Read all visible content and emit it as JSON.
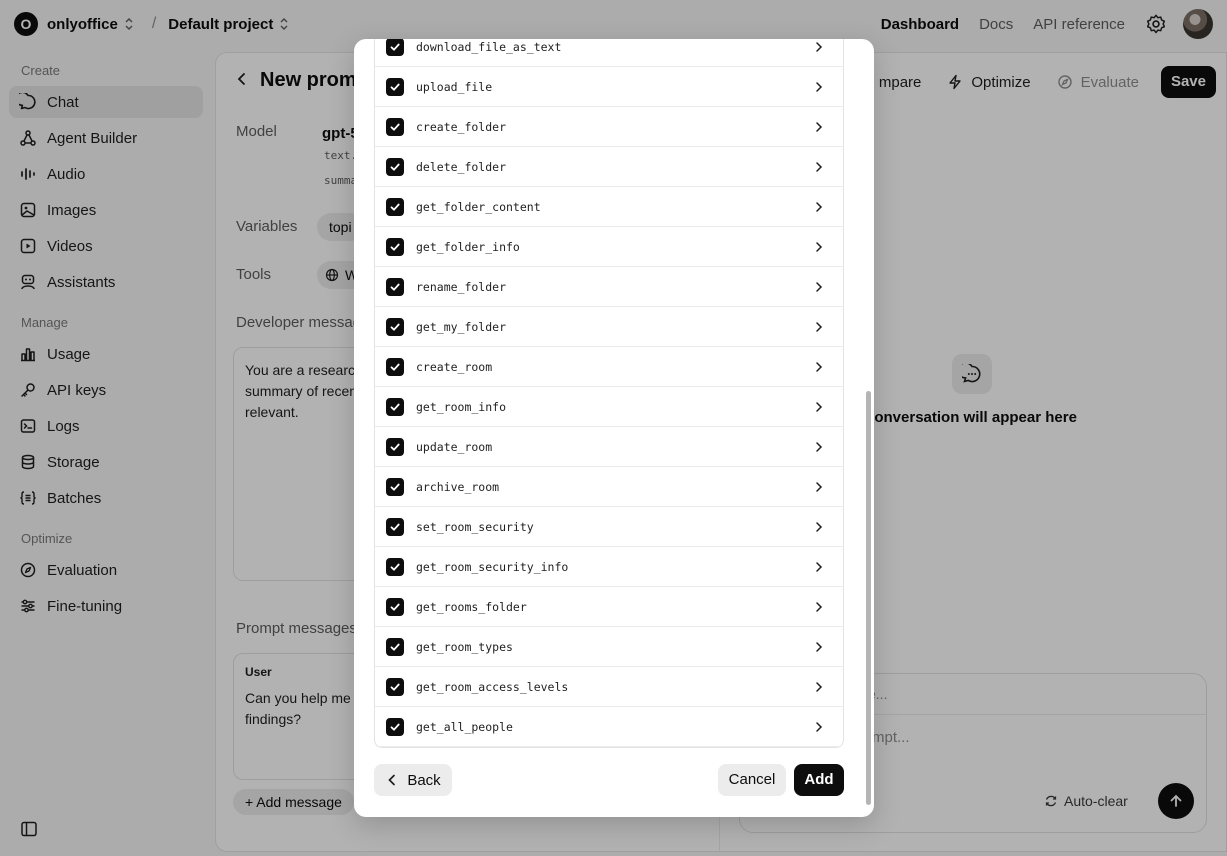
{
  "topbar": {
    "org_initial": "O",
    "org_name": "onlyoffice",
    "separator": "/",
    "project_name": "Default project",
    "links": [
      "Dashboard",
      "Docs",
      "API reference"
    ]
  },
  "sidebar": {
    "sections": [
      {
        "label": "Create",
        "items": [
          {
            "label": "Chat",
            "icon": "chat-icon",
            "active": true
          },
          {
            "label": "Agent Builder",
            "icon": "agent-builder-icon"
          },
          {
            "label": "Audio",
            "icon": "audio-icon"
          },
          {
            "label": "Images",
            "icon": "images-icon"
          },
          {
            "label": "Videos",
            "icon": "videos-icon"
          },
          {
            "label": "Assistants",
            "icon": "assistants-icon"
          }
        ]
      },
      {
        "label": "Manage",
        "items": [
          {
            "label": "Usage",
            "icon": "usage-icon"
          },
          {
            "label": "API keys",
            "icon": "key-icon"
          },
          {
            "label": "Logs",
            "icon": "logs-icon"
          },
          {
            "label": "Storage",
            "icon": "storage-icon"
          },
          {
            "label": "Batches",
            "icon": "batches-icon"
          }
        ]
      },
      {
        "label": "Optimize",
        "items": [
          {
            "label": "Evaluation",
            "icon": "evaluation-icon"
          },
          {
            "label": "Fine-tuning",
            "icon": "fine-tuning-icon"
          }
        ]
      }
    ]
  },
  "main": {
    "title": "New promp",
    "actions": {
      "compare": "mpare",
      "optimize": "Optimize",
      "evaluate": "Evaluate",
      "save": "Save"
    },
    "model_label": "Model",
    "model_value": "gpt-5",
    "model_meta_1": "text.",
    "model_meta_2": "summa",
    "variables_label": "Variables",
    "variable_pill": "topi",
    "tools_label": "Tools",
    "tool_pill": "W",
    "developer_label": "Developer message",
    "developer_text": "You are a research\nsummary of recen\nrelevant.",
    "prompt_messages_label": "Prompt messages",
    "user_role": "User",
    "user_text": "Can you help me\nfindings?",
    "add_message": "Add message",
    "conversation_placeholder": "r conversation will appear here",
    "chat_input_top": "e...",
    "chat_input_placeholder": "mpt...",
    "auto_clear": "Auto-clear"
  },
  "modal": {
    "tools": [
      "download_file_as_text",
      "upload_file",
      "create_folder",
      "delete_folder",
      "get_folder_content",
      "get_folder_info",
      "rename_folder",
      "get_my_folder",
      "create_room",
      "get_room_info",
      "update_room",
      "archive_room",
      "set_room_security",
      "get_room_security_info",
      "get_rooms_folder",
      "get_room_types",
      "get_room_access_levels",
      "get_all_people"
    ],
    "back": "Back",
    "cancel": "Cancel",
    "add": "Add"
  },
  "colors": {
    "primary": "#0d0d0d",
    "muted": "#ececec",
    "overlay": "rgba(0,0,0,0.30)"
  }
}
